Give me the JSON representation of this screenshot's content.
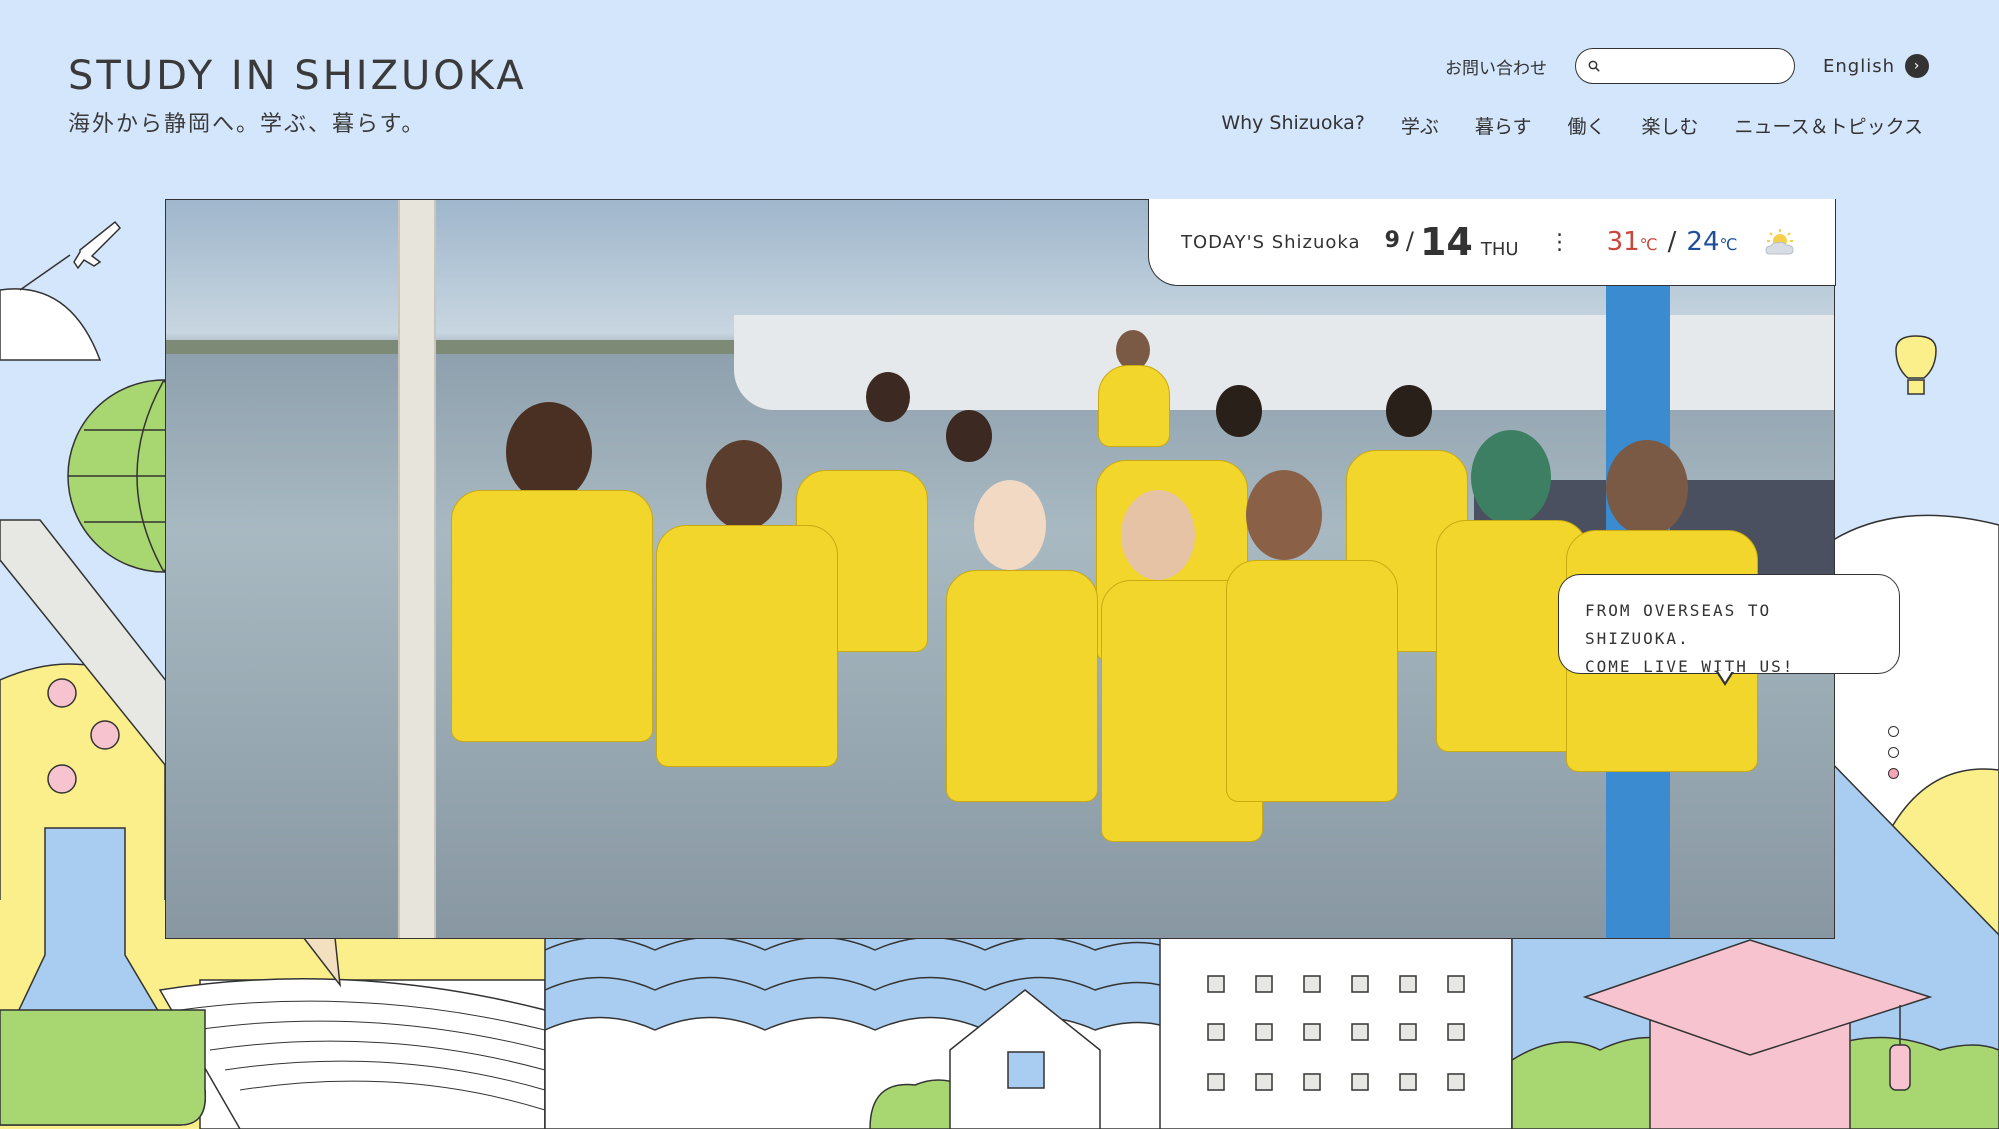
{
  "header": {
    "title": "STUDY IN SHIZUOKA",
    "subtitle": "海外から静岡へ。学ぶ、暮らす。",
    "contact_label": "お問い合わせ",
    "search_placeholder": "",
    "language_label": "English"
  },
  "nav": {
    "items": [
      {
        "label": "Why Shizuoka?"
      },
      {
        "label": "学ぶ"
      },
      {
        "label": "暮らす"
      },
      {
        "label": "働く"
      },
      {
        "label": "楽しむ"
      },
      {
        "label": "ニュース＆トピックス"
      }
    ]
  },
  "weather": {
    "label": "TODAY'S Shizuoka",
    "month": "9",
    "day": "14",
    "weekday": "THU",
    "high": "31",
    "low": "24",
    "unit": "℃",
    "icon": "sun-cloud-icon"
  },
  "bubble": {
    "line1": "FROM OVERSEAS TO SHIZUOKA.",
    "line2": "COME LIVE WITH US!"
  },
  "slider": {
    "total": 3,
    "active": 3
  },
  "colors": {
    "background": "#d4e6fb",
    "high_temp": "#c8463a",
    "low_temp": "#1e4f9a",
    "yellow": "#fbef8c",
    "green": "#a8d670",
    "pink": "#f7c3cf",
    "sky": "#a9cdf0"
  }
}
